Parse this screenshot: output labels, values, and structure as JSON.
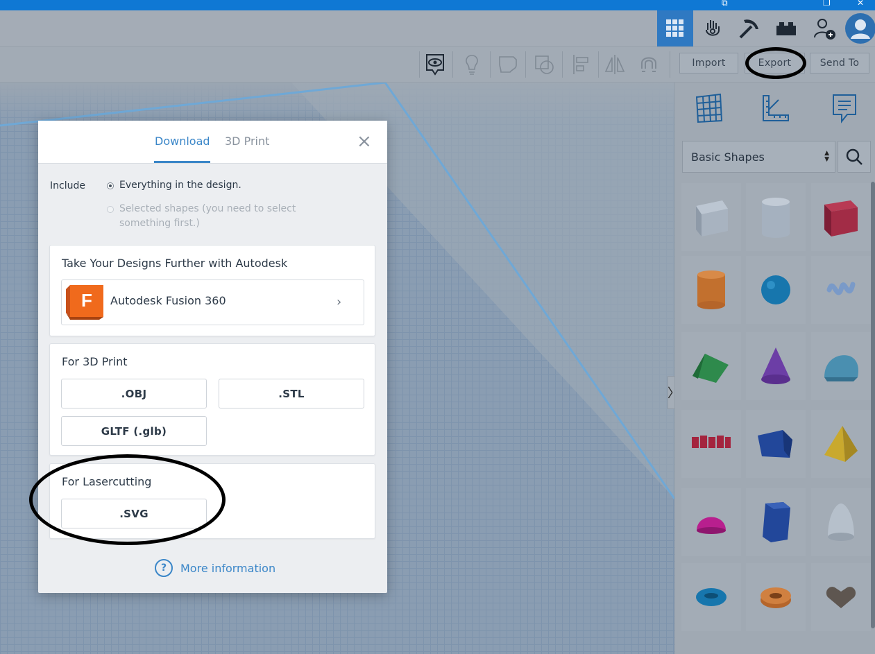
{
  "colors": {
    "accent": "#3a86c8",
    "titlebar": "#0f78d4",
    "active_view": "#2f79c2",
    "annotation": "#000000"
  },
  "topbar": {
    "icons": [
      "grid-view-icon",
      "hand-gesture-icon",
      "pickaxe-icon",
      "brick-icon",
      "add-user-icon",
      "avatar-icon"
    ]
  },
  "toolbar": {
    "tools": [
      "view-icon",
      "lightbulb-icon",
      "shape-note-icon",
      "group-icon",
      "align-icon",
      "mirror-icon",
      "magnet-icon"
    ],
    "import_label": "Import",
    "export_label": "Export",
    "send_label": "Send To"
  },
  "panel": {
    "view_icons": [
      "workplane-icon",
      "ruler-icon",
      "note-icon"
    ],
    "shapes_select": "Basic Shapes",
    "shapes": [
      "box",
      "cylinder-striped",
      "box-red",
      "cylinder-orange",
      "sphere",
      "scribble",
      "roof",
      "cone",
      "round-roof",
      "text",
      "polygon",
      "pyramid",
      "half-sphere",
      "hexagonal-prism",
      "paraboloid",
      "torus",
      "tube",
      "heart"
    ]
  },
  "modal": {
    "tabs": [
      "Download",
      "3D Print"
    ],
    "include_label": "Include",
    "option_all": "Everything in the design.",
    "option_selected_1": "Selected shapes (you need to select",
    "option_selected_2": "something first.)",
    "autodesk": {
      "title": "Take Your Designs Further with Autodesk",
      "product": "Autodesk Fusion 360",
      "logo_letter": "F"
    },
    "print": {
      "title": "For 3D Print",
      "obj": ".OBJ",
      "stl": ".STL",
      "gltf": "GLTF (.glb)"
    },
    "laser": {
      "title": "For Lasercutting",
      "svg": ".SVG"
    },
    "more_info": "More information"
  }
}
